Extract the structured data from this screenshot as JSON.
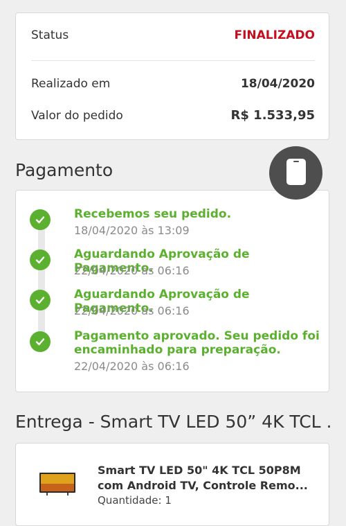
{
  "summary": {
    "status_label": "Status",
    "status_value": "FINALIZADO",
    "date_label": "Realizado em",
    "date_value": "18/04/2020",
    "total_label": "Valor do pedido",
    "total_value": "R$ 1.533,95"
  },
  "payment": {
    "title": "Pagamento",
    "steps": [
      {
        "title": "Recebemos seu pedido.",
        "date": "18/04/2020 às 13:09"
      },
      {
        "title": "Aguardando Aprovação de Pagamento.",
        "date": "22/04/2020 às 06:16"
      },
      {
        "title": "Aguardando Aprovação de Pagamento.",
        "date": "22/04/2020 às 06:16"
      },
      {
        "title_line1": "Pagamento aprovado. Seu pedido foi",
        "title_line2": "encaminhado para preparação.",
        "date": "22/04/2020 às 06:16"
      }
    ]
  },
  "delivery": {
    "title": "Entrega - Smart TV LED 50” 4K TCL ..."
  },
  "product": {
    "name_line1": "Smart TV LED 50\" 4K TCL 50P8M",
    "name_line2": "com Android TV, Controle Remo...",
    "quantity": "Quantidade: 1"
  },
  "colors": {
    "status_red": "#c30f1e",
    "success_green": "#5bb12f",
    "floating_button": "#4e4e4e"
  },
  "icons": {
    "step_icon": "check-circle-icon",
    "floating_button_icon": "phone-icon"
  }
}
